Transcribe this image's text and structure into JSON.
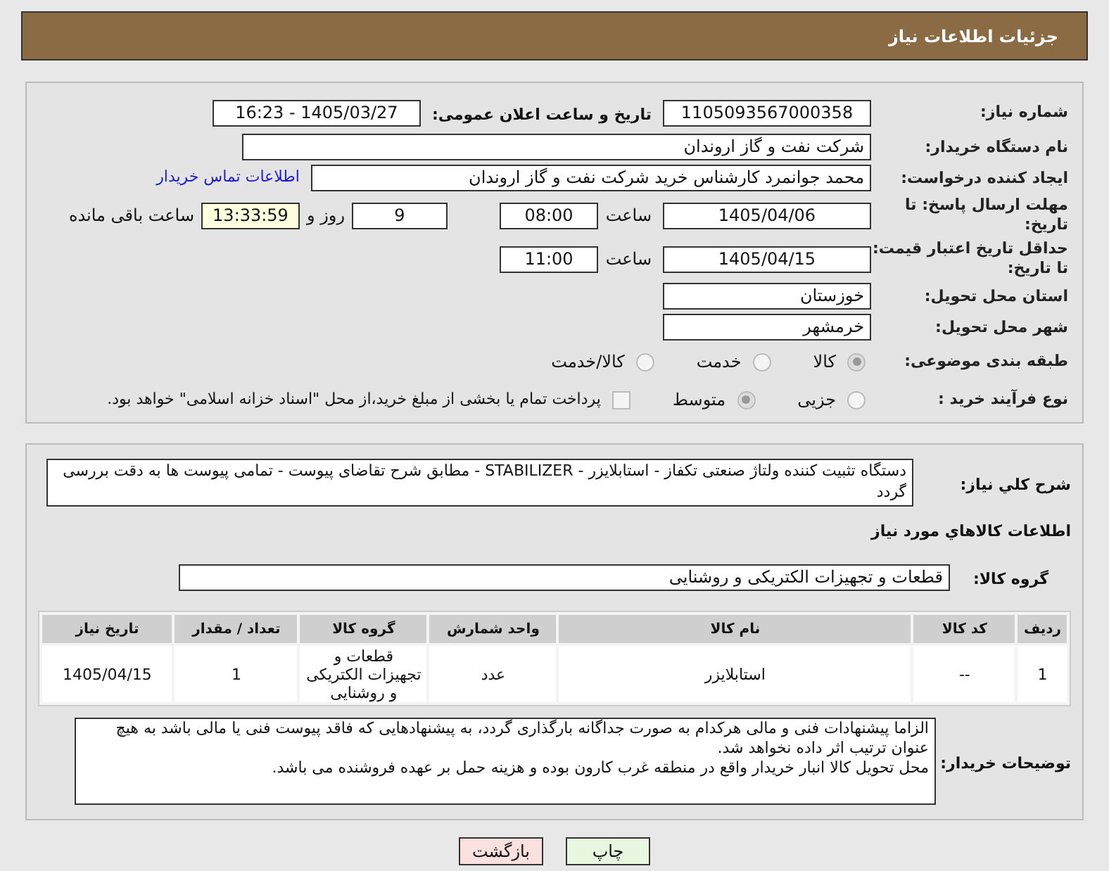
{
  "header": {
    "title": "جزئیات اطلاعات نیاز"
  },
  "need_number": {
    "label": "شماره نیاز:",
    "value": "1105093567000358"
  },
  "announce": {
    "label": "تاریخ و ساعت اعلان عمومی:",
    "value": "1405/03/27 - 16:23"
  },
  "buyer_org": {
    "label": "نام دستگاه خریدار:",
    "value": "شرکت نفت و گاز اروندان"
  },
  "requester": {
    "label": "ایجاد کننده درخواست:",
    "value": "محمد جوانمرد کارشناس خرید شرکت نفت و گاز اروندان",
    "link": "اطلاعات تماس خریدار"
  },
  "deadline": {
    "label": "مهلت ارسال پاسخ: تا تاریخ:",
    "date": "1405/04/06",
    "time_label": "ساعت",
    "time": "08:00",
    "days": "9",
    "days_label": "روز و",
    "remaining": "13:33:59",
    "remaining_label": "ساعت باقی مانده"
  },
  "validity": {
    "label": "حداقل تاریخ اعتبار قیمت: تا تاریخ:",
    "date": "1405/04/15",
    "time_label": "ساعت",
    "time": "11:00"
  },
  "province": {
    "label": "استان محل تحویل:",
    "value": "خوزستان"
  },
  "city": {
    "label": "شهر محل تحویل:",
    "value": "خرمشهر"
  },
  "category": {
    "label": "طبقه بندی موضوعی:",
    "options": [
      {
        "label": "کالا",
        "selected": true
      },
      {
        "label": "خدمت",
        "selected": false
      },
      {
        "label": "کالا/خدمت",
        "selected": false
      }
    ]
  },
  "process": {
    "label": "نوع فرآیند خرید :",
    "options": [
      {
        "label": "جزیی",
        "selected": false
      },
      {
        "label": "متوسط",
        "selected": true
      }
    ],
    "payment": {
      "label": "پرداخت تمام یا بخشی از مبلغ خرید،از محل \"اسناد خزانه اسلامی\" خواهد بود.",
      "checked": false
    }
  },
  "description": {
    "label": "شرح کلي نياز:",
    "value": "دستگاه تثبیت کننده ولتاژ صنعتی تکفاز - استابلایزر - STABILIZER - مطابق شرح تقاضای پیوست - تمامی پیوست ها به دقت بررسی گردد"
  },
  "goods_title": "اطلاعات کالاهاي مورد نياز",
  "goods_group": {
    "label": "گروه کالا:",
    "value": "قطعات و تجهیزات الکتریکی و روشنایی"
  },
  "table": {
    "columns": [
      "ردیف",
      "کد کالا",
      "نام کالا",
      "واحد شمارش",
      "گروه کالا",
      "تعداد / مقدار",
      "تاریخ نیاز"
    ],
    "rows": [
      [
        "1",
        "--",
        "استابلایزر",
        "عدد",
        "قطعات و تجهیزات الکتریکی و روشنایی",
        "1",
        "1405/04/15"
      ]
    ]
  },
  "buyer_notes": {
    "label": "توضیحات خریدار:",
    "lines": [
      "الزاما پیشنهادات فنی و مالی هرکدام به صورت جداگانه بارگذاری گردد، به پیشنهادهایی که فاقد پیوست فنی یا مالی باشد به هیچ عنوان ترتیب اثر داده نخواهد شد.",
      "محل تحویل کالا انبار خریدار واقع در منطقه غرب کارون بوده و هزینه حمل بر عهده فروشنده می باشد."
    ]
  },
  "buttons": [
    {
      "label": "چاپ",
      "kind": "print"
    },
    {
      "label": "بازگشت",
      "kind": "back"
    }
  ]
}
